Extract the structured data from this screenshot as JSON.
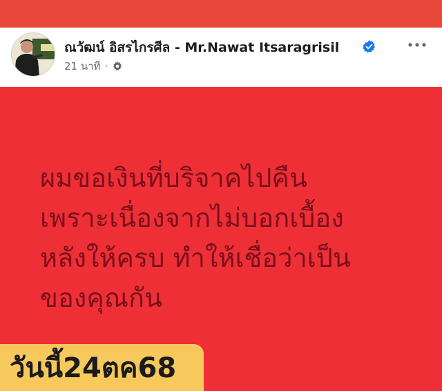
{
  "post": {
    "author": "ณวัฒน์ อิสรไกรศีล - Mr.Nawat Itsaragrisil",
    "timestamp": "21 นาที",
    "text": "ผมขอเงินที่บริจาคไปคืน\nเพราะเนื่องจากไม่บอกเบื้อง\nหลังให้ครบ ทำให้เชื่อว่าเป็น\nของคุณกัน",
    "icons": {
      "verified": "verified-badge-icon",
      "audience": "gear-icon",
      "more": "more-options-icon"
    }
  },
  "overlay": {
    "date_label": "วันนี้24ตค68"
  },
  "colors": {
    "top_strip": "#e8473a",
    "post_background": "#ef2f36",
    "post_text": "#7a0f1c",
    "date_badge": "#f7c85c",
    "verified": "#1877f2"
  }
}
